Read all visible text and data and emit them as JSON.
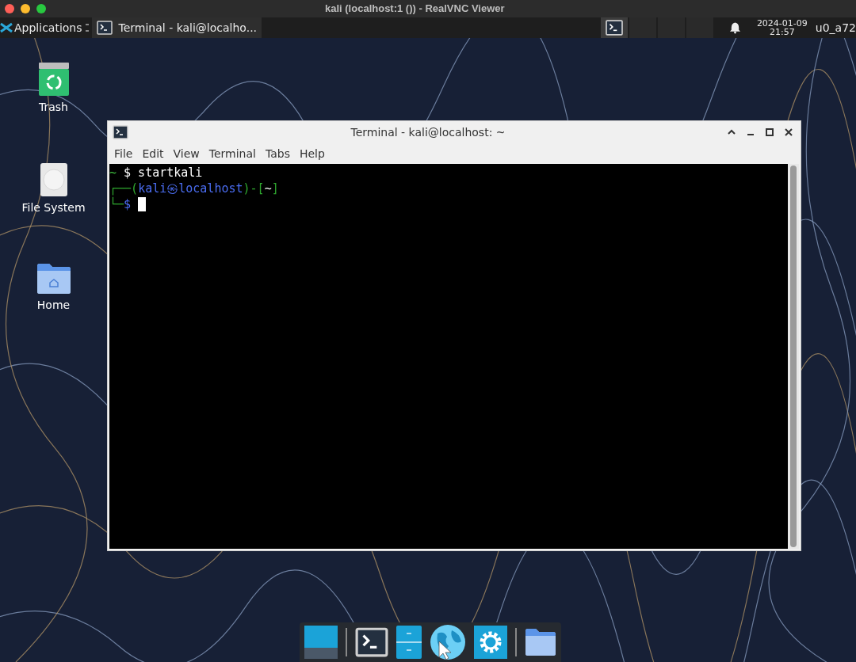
{
  "host_window": {
    "title": "kali (localhost:1 ()) - RealVNC Viewer"
  },
  "panel": {
    "menu": "Applications",
    "tasks": [
      {
        "label": "Terminal - kali@localho...",
        "selected": true
      }
    ],
    "workspaces": [
      {
        "selected": true,
        "has_window": true
      },
      {
        "selected": false,
        "has_window": false
      },
      {
        "selected": false,
        "has_window": false
      },
      {
        "selected": false,
        "has_window": false
      }
    ],
    "date": "2024-01-09",
    "time": "21:57",
    "user": "u0_a72"
  },
  "desktop_icons": [
    {
      "kind": "trash",
      "label": "Trash"
    },
    {
      "kind": "drive",
      "label": "File System"
    },
    {
      "kind": "home",
      "label": "Home"
    }
  ],
  "terminal": {
    "title": "Terminal - kali@localhost: ~",
    "menu": [
      "File",
      "Edit",
      "View",
      "Terminal",
      "Tabs",
      "Help"
    ],
    "lines": [
      {
        "segments": [
          {
            "text": "~",
            "color": "#3fbf3f"
          },
          {
            "text": " $ startkali",
            "color": "#ffffff"
          }
        ],
        "cursor": false
      },
      {
        "segments": [
          {
            "text": "┌──(",
            "color": "#2fa82f"
          },
          {
            "text": "kali㉿localhost",
            "color": "#4a6cf0"
          },
          {
            "text": ")-[",
            "color": "#2fa82f"
          },
          {
            "text": "~",
            "color": "#ffffff"
          },
          {
            "text": "]",
            "color": "#2fa82f"
          }
        ],
        "cursor": false
      },
      {
        "segments": [
          {
            "text": "└─",
            "color": "#2fa82f"
          },
          {
            "text": "$",
            "color": "#4a6cf0"
          }
        ],
        "cursor": true
      }
    ]
  },
  "dock": [
    {
      "kind": "desktop"
    },
    {
      "kind": "terminal"
    },
    {
      "kind": "files"
    },
    {
      "kind": "browser"
    },
    {
      "kind": "settings"
    },
    {
      "kind": "folder"
    }
  ]
}
